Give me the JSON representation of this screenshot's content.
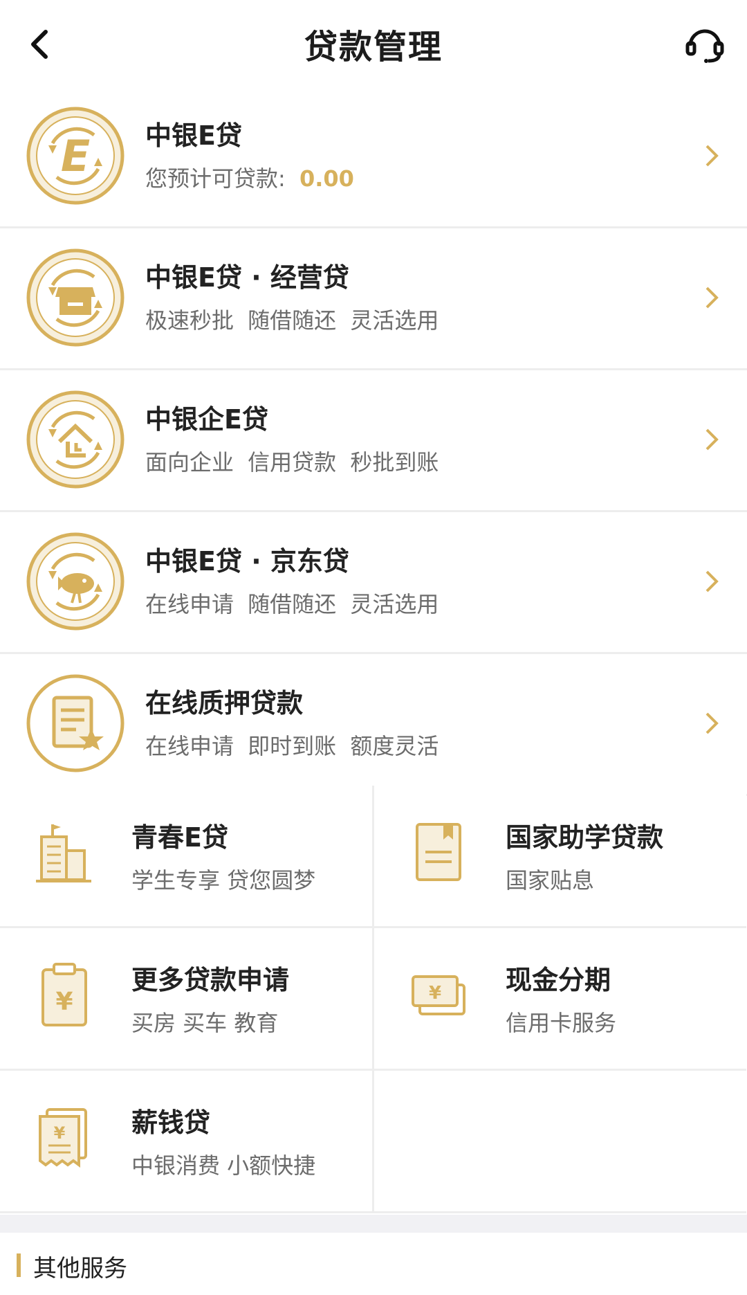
{
  "header": {
    "title": "贷款管理"
  },
  "rows": [
    {
      "title": "中银E贷",
      "sub_prefix": "您预计可贷款: ",
      "amount": "0.00"
    },
    {
      "title": "中银E贷 · 经营贷",
      "sub": "极速秒批  随借随还  灵活选用"
    },
    {
      "title": "中银企E贷",
      "sub": "面向企业  信用贷款  秒批到账"
    },
    {
      "title": "中银E贷 · 京东贷",
      "sub": "在线申请  随借随还  灵活选用"
    },
    {
      "title": "在线质押贷款",
      "sub": "在线申请  即时到账  额度灵活"
    }
  ],
  "grid": [
    {
      "title": "青春E贷",
      "sub": "学生专享 贷您圆梦"
    },
    {
      "title": "国家助学贷款",
      "sub": "国家贴息"
    },
    {
      "title": "更多贷款申请",
      "sub": "买房 买车 教育"
    },
    {
      "title": "现金分期",
      "sub": "信用卡服务"
    },
    {
      "title": "薪钱贷",
      "sub": "中银消费 小额快捷"
    }
  ],
  "other": {
    "label": "其他服务"
  },
  "colors": {
    "accent": "#d7b15c",
    "icon_fill": "#f7efdc"
  }
}
